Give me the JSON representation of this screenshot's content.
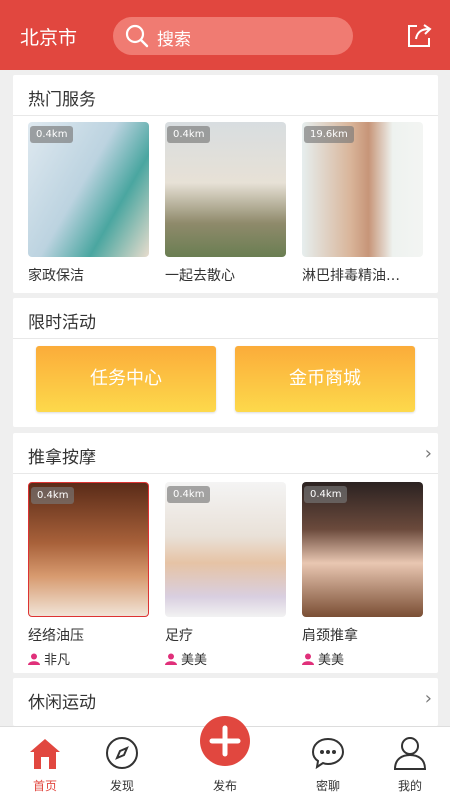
{
  "header": {
    "city": "北京市",
    "search_placeholder": "搜索"
  },
  "hot": {
    "title": "热门服务",
    "items": [
      {
        "distance": "0.4km",
        "label": "家政保洁"
      },
      {
        "distance": "0.4km",
        "label": "一起去散心"
      },
      {
        "distance": "19.6km",
        "label": "淋巴排毒精油…"
      }
    ]
  },
  "activity": {
    "title": "限时活动",
    "buttons": [
      "任务中心",
      "金币商城"
    ]
  },
  "massage": {
    "title": "推拿按摩",
    "items": [
      {
        "distance": "0.4km",
        "label": "经络油压",
        "user": "非凡"
      },
      {
        "distance": "0.4km",
        "label": "足疗",
        "user": "美美"
      },
      {
        "distance": "0.4km",
        "label": "肩颈推拿",
        "user": "美美"
      }
    ]
  },
  "leisure": {
    "title": "休闲运动"
  },
  "tabbar": {
    "items": [
      "首页",
      "发现",
      "发布",
      "密聊",
      "我的"
    ],
    "active_color": "#e1473f"
  }
}
